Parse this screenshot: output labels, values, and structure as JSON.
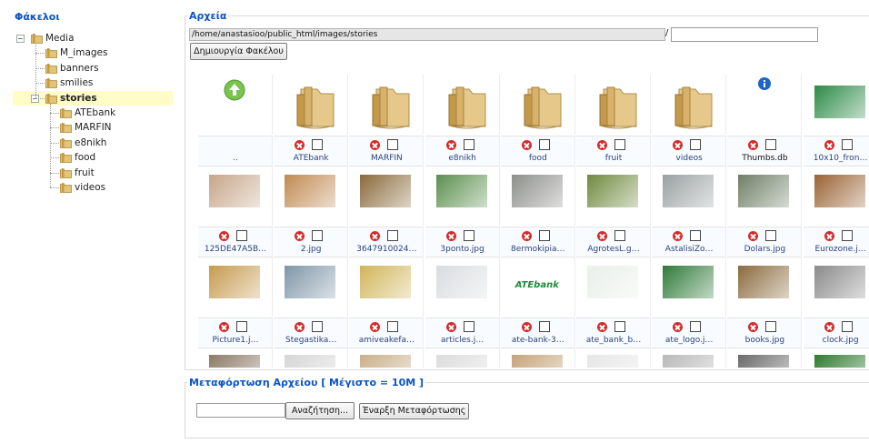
{
  "folders_panel": {
    "title": "Φάκελοι",
    "tree": [
      {
        "label": "Media",
        "level": 0,
        "expander": "−",
        "selected": false
      },
      {
        "label": "M_images",
        "level": 1,
        "selected": false
      },
      {
        "label": "banners",
        "level": 1,
        "selected": false
      },
      {
        "label": "smilies",
        "level": 1,
        "selected": false
      },
      {
        "label": "stories",
        "level": 1,
        "expander": "−",
        "selected": true
      },
      {
        "label": "ATEbank",
        "level": 2,
        "selected": false
      },
      {
        "label": "MARFIN",
        "level": 2,
        "selected": false
      },
      {
        "label": "e8nikh",
        "level": 2,
        "selected": false
      },
      {
        "label": "food",
        "level": 2,
        "selected": false
      },
      {
        "label": "fruit",
        "level": 2,
        "selected": false
      },
      {
        "label": "videos",
        "level": 2,
        "selected": false
      }
    ]
  },
  "files_panel": {
    "title": "Αρχεία",
    "path": "/home/anastasioo/public_html/images/stories",
    "separator": "/",
    "new_folder_value": "",
    "create_folder_button": "Δημιουργία Φακέλου",
    "rows": [
      [
        {
          "name": "..",
          "kind": "up",
          "deletable": false
        },
        {
          "name": "ATEbank",
          "kind": "folder",
          "deletable": true
        },
        {
          "name": "MARFIN",
          "kind": "folder",
          "deletable": true
        },
        {
          "name": "e8nikh",
          "kind": "folder",
          "deletable": true
        },
        {
          "name": "food",
          "kind": "folder",
          "deletable": true
        },
        {
          "name": "fruit",
          "kind": "folder",
          "deletable": true
        },
        {
          "name": "videos",
          "kind": "folder",
          "deletable": true
        },
        {
          "name": "Thumbs.db",
          "kind": "info",
          "deletable": true
        },
        {
          "name": "10x10_fron…",
          "kind": "image",
          "color": "#2c8a46",
          "deletable": true
        }
      ],
      [
        {
          "name": "125DE47A5B…",
          "kind": "image",
          "color": "#c7a68a",
          "deletable": true
        },
        {
          "name": "2.jpg",
          "kind": "image",
          "color": "#c08a52",
          "deletable": true
        },
        {
          "name": "3647910024…",
          "kind": "image",
          "color": "#8a6a3c",
          "deletable": true
        },
        {
          "name": "3ponto.jpg",
          "kind": "image",
          "color": "#5b8f4e",
          "deletable": true
        },
        {
          "name": "8ermokipia…",
          "kind": "image",
          "color": "#8d8f8a",
          "deletable": true
        },
        {
          "name": "AgrotesL.g…",
          "kind": "image",
          "color": "#6f8a3f",
          "deletable": true
        },
        {
          "name": "AstalisiZo…",
          "kind": "image",
          "color": "#9aa1a2",
          "deletable": true
        },
        {
          "name": "Dolars.jpg",
          "kind": "image",
          "color": "#6f7f66",
          "deletable": true
        },
        {
          "name": "Eurozone.j…",
          "kind": "image",
          "color": "#9a6335",
          "deletable": true
        }
      ],
      [
        {
          "name": "Picture1.j…",
          "kind": "image",
          "color": "#c69a4f",
          "deletable": true
        },
        {
          "name": "Stegastika…",
          "kind": "image",
          "color": "#7f96a8",
          "deletable": true
        },
        {
          "name": "amiveakefa…",
          "kind": "image",
          "color": "#d1b55a",
          "deletable": true
        },
        {
          "name": "articles.j…",
          "kind": "image",
          "color": "#d9dcdf",
          "deletable": true
        },
        {
          "name": "ate-bank-3…",
          "kind": "logo",
          "text": "ATEbank",
          "color": "#1f8a3a",
          "deletable": true
        },
        {
          "name": "ate_bank_b…",
          "kind": "image",
          "color": "#e9efe9",
          "deletable": true
        },
        {
          "name": "ate_logo.j…",
          "kind": "image",
          "color": "#2f7a39",
          "deletable": true
        },
        {
          "name": "books.jpg",
          "kind": "image",
          "color": "#8b6a3e",
          "deletable": true
        },
        {
          "name": "clock.jpg",
          "kind": "image",
          "color": "#8a8a8a",
          "deletable": true
        }
      ],
      [
        {
          "name": "",
          "kind": "image",
          "color": "#8c7a66",
          "deletable": false
        },
        {
          "name": "",
          "kind": "image",
          "color": "#d6d6d6",
          "deletable": false
        },
        {
          "name": "",
          "kind": "image",
          "color": "#c9b08a",
          "deletable": false
        },
        {
          "name": "",
          "kind": "image",
          "color": "#dcdcdc",
          "deletable": false
        },
        {
          "name": "",
          "kind": "image",
          "color": "#c6a37a",
          "deletable": false
        },
        {
          "name": "",
          "kind": "image",
          "color": "#e6e6e6",
          "deletable": false
        },
        {
          "name": "",
          "kind": "image",
          "color": "#b9b9b9",
          "deletable": false
        },
        {
          "name": "",
          "kind": "image",
          "color": "#6a6a6a",
          "deletable": false
        },
        {
          "name": "",
          "kind": "image",
          "color": "#2f7a2f",
          "deletable": false
        }
      ]
    ]
  },
  "upload_panel": {
    "title": "Μεταφόρτωση Αρχείου [ Μέγιστο = 10M ]",
    "file_value": "",
    "browse_button": "Αναζήτηση...",
    "start_button": "Έναρξη Μεταφόρτωσης"
  },
  "colors": {
    "accent": "#0b55c4",
    "selected_bg": "#fffcc8",
    "folder": "#d9b86a"
  }
}
